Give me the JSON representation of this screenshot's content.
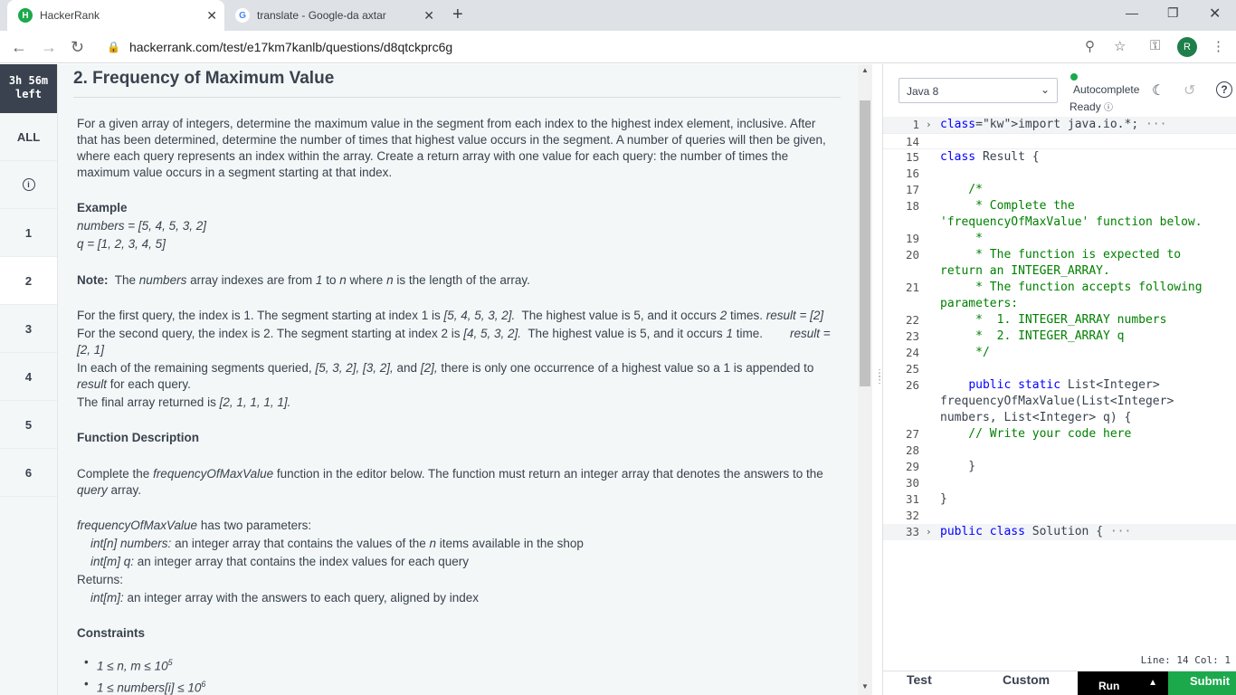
{
  "browser": {
    "tabs": [
      {
        "title": "HackerRank",
        "active": true
      },
      {
        "title": "translate - Google-da axtar",
        "active": false
      }
    ],
    "url": "hackerrank.com/test/e17km7kanlb/questions/d8qtckprc6g",
    "profile_initial": "R"
  },
  "sidebar": {
    "timer_line1": "3h 56m",
    "timer_line2": "left",
    "all_label": "ALL",
    "questions": [
      "1",
      "2",
      "3",
      "4",
      "5",
      "6"
    ],
    "active_question": "2"
  },
  "problem": {
    "title": "2. Frequency of Maximum Value",
    "intro": "For a given array of integers, determine the maximum value in the segment from each index to the highest index element, inclusive. After that has been determined, determine the number of times that highest value occurs in the segment. A number of queries will then be given, where each query represents an index within the array. Create a return array with one value for each query: the number of times the maximum value occurs in a segment starting at that index.",
    "example_heading": "Example",
    "example_numbers": "numbers = [5, 4, 5, 3, 2]",
    "example_q": "q = [1, 2, 3, 4, 5]",
    "note_label": "Note:",
    "note_text_1": "The",
    "note_italic_1": "numbers",
    "note_text_2": "array indexes are from",
    "note_italic_2": "1",
    "note_text_3": "to",
    "note_italic_3": "n",
    "note_text_4": "where",
    "note_italic_4": "n",
    "note_text_5": "is the length of the array.",
    "query1_a": "For the first query, the index is 1. The segment starting at index 1 is",
    "query1_b": "[5, 4, 5, 3, 2].",
    "query1_c": "The highest value is 5, and it occurs",
    "query1_d": "2",
    "query1_e": "times.",
    "query1_f": "result = [2]",
    "query2_a": "For the second query, the index is 2. The segment starting at index 2 is",
    "query2_b": "[4, 5, 3, 2].",
    "query2_c": "The highest value is 5, and it occurs",
    "query2_d": "1",
    "query2_e": "time.",
    "query2_f": "result = [2, 1]",
    "remaining_a": "In each of the remaining segments queried,",
    "remaining_b": "[5, 3, 2], [3, 2],",
    "remaining_c": "and",
    "remaining_d": "[2],",
    "remaining_e": "there is only one occurrence of a highest value so a 1 is appended to",
    "remaining_f": "result",
    "remaining_g": "for each query.",
    "final_a": "The final array returned is",
    "final_b": "[2, 1, 1, 1, 1].",
    "func_heading": "Function Description",
    "func_a": "Complete the",
    "func_b": "frequencyOfMaxValue",
    "func_c": "function in the editor below. The function must return an integer array that denotes the answers to the",
    "func_d": "query",
    "func_e": "array.",
    "params_a": "frequencyOfMaxValue",
    "params_b": "has two parameters:",
    "param1_a": "int[n] numbers:",
    "param1_b": "an integer array that contains the values of the",
    "param1_c": "n",
    "param1_d": "items available in the shop",
    "param2_a": "int[m] q:",
    "param2_b": "an integer array that contains the index values for each query",
    "returns_label": "Returns:",
    "returns_a": "int[m]:",
    "returns_b": "an integer array with the answers to each query, aligned by index",
    "constraints_heading": "Constraints",
    "constraint1": "1 ≤ n, m ≤ 10",
    "constraint1_exp": "5",
    "constraint2": "1 ≤ numbers[i] ≤ 10",
    "constraint2_exp": "6"
  },
  "editor": {
    "language": "Java 8",
    "autocomplete_label": "Autocomplete",
    "ready_label": "Ready",
    "status": "Line: 14 Col: 1",
    "test_tab": "Test",
    "custom_tab": "Custom",
    "run_label": "Run",
    "submit_label": "Submit",
    "lines": [
      {
        "n": "1",
        "t": "import java.io.*;",
        "fold": true
      },
      {
        "n": "14",
        "t": ""
      },
      {
        "n": "15",
        "t": "class Result {"
      },
      {
        "n": "16",
        "t": ""
      },
      {
        "n": "17",
        "t": "    /*"
      },
      {
        "n": "18",
        "t": "     * Complete the"
      },
      {
        "n": "",
        "t": "'frequencyOfMaxValue' function below."
      },
      {
        "n": "19",
        "t": "     *"
      },
      {
        "n": "20",
        "t": "     * The function is expected to"
      },
      {
        "n": "",
        "t": "return an INTEGER_ARRAY."
      },
      {
        "n": "21",
        "t": "     * The function accepts following"
      },
      {
        "n": "",
        "t": "parameters:"
      },
      {
        "n": "22",
        "t": "     *  1. INTEGER_ARRAY numbers"
      },
      {
        "n": "23",
        "t": "     *  2. INTEGER_ARRAY q"
      },
      {
        "n": "24",
        "t": "     */"
      },
      {
        "n": "25",
        "t": ""
      },
      {
        "n": "26",
        "t": "    public static List<Integer>"
      },
      {
        "n": "",
        "t": "frequencyOfMaxValue(List<Integer>"
      },
      {
        "n": "",
        "t": "numbers, List<Integer> q) {"
      },
      {
        "n": "27",
        "t": "    // Write your code here"
      },
      {
        "n": "28",
        "t": ""
      },
      {
        "n": "29",
        "t": "    }"
      },
      {
        "n": "30",
        "t": ""
      },
      {
        "n": "31",
        "t": "}"
      },
      {
        "n": "32",
        "t": ""
      },
      {
        "n": "33",
        "t": "public class Solution {",
        "fold": true
      }
    ]
  }
}
